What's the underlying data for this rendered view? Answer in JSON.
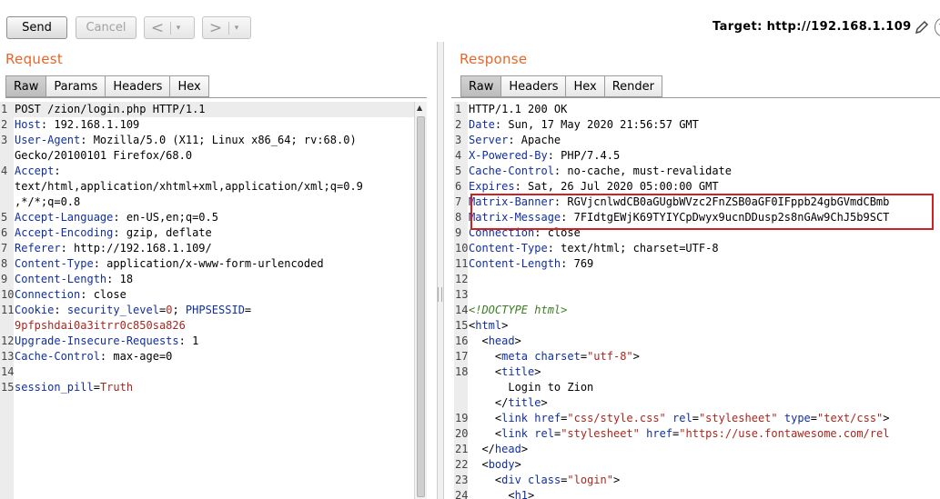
{
  "toolbar": {
    "send": "Send",
    "cancel": "Cancel",
    "back": "<",
    "forward": ">",
    "dropdown": "▾",
    "target_label": "Target: ",
    "target_value": "http://192.168.1.109"
  },
  "request": {
    "title": "Request",
    "tabs": [
      "Raw",
      "Params",
      "Headers",
      "Hex"
    ],
    "active_tab": "Raw",
    "lines": [
      {
        "n": "1",
        "parts": [
          {
            "t": "POST /zion/login.php HTTP/1.1",
            "c": ""
          }
        ]
      },
      {
        "n": "2",
        "parts": [
          {
            "t": "Host",
            "c": "k"
          },
          {
            "t": ": 192.168.1.109",
            "c": ""
          }
        ]
      },
      {
        "n": "3",
        "parts": [
          {
            "t": "User-Agent",
            "c": "k"
          },
          {
            "t": ": Mozilla/5.0 (X11; Linux x86_64; rv:68.0)",
            "c": ""
          }
        ]
      },
      {
        "n": "",
        "parts": [
          {
            "t": "Gecko/20100101 Firefox/68.0",
            "c": ""
          }
        ]
      },
      {
        "n": "4",
        "parts": [
          {
            "t": "Accept",
            "c": "k"
          },
          {
            "t": ":",
            "c": ""
          }
        ]
      },
      {
        "n": "",
        "parts": [
          {
            "t": "text/html,application/xhtml+xml,application/xml;q=0.9",
            "c": ""
          }
        ]
      },
      {
        "n": "",
        "parts": [
          {
            "t": ",*/*;q=0.8",
            "c": ""
          }
        ]
      },
      {
        "n": "5",
        "parts": [
          {
            "t": "Accept-Language",
            "c": "k"
          },
          {
            "t": ": en-US,en;q=0.5",
            "c": ""
          }
        ]
      },
      {
        "n": "6",
        "parts": [
          {
            "t": "Accept-Encoding",
            "c": "k"
          },
          {
            "t": ": gzip, deflate",
            "c": ""
          }
        ]
      },
      {
        "n": "7",
        "parts": [
          {
            "t": "Referer",
            "c": "k"
          },
          {
            "t": ": http://192.168.1.109/",
            "c": ""
          }
        ]
      },
      {
        "n": "8",
        "parts": [
          {
            "t": "Content-Type",
            "c": "k"
          },
          {
            "t": ": application/x-www-form-urlencoded",
            "c": ""
          }
        ]
      },
      {
        "n": "9",
        "parts": [
          {
            "t": "Content-Length",
            "c": "k"
          },
          {
            "t": ": 18",
            "c": ""
          }
        ]
      },
      {
        "n": "10",
        "parts": [
          {
            "t": "Connection",
            "c": "k"
          },
          {
            "t": ": close",
            "c": ""
          }
        ]
      },
      {
        "n": "11",
        "parts": [
          {
            "t": "Cookie",
            "c": "k"
          },
          {
            "t": ": ",
            "c": ""
          },
          {
            "t": "security_level",
            "c": "k"
          },
          {
            "t": "=",
            "c": ""
          },
          {
            "t": "0",
            "c": "v"
          },
          {
            "t": "; ",
            "c": ""
          },
          {
            "t": "PHPSESSID",
            "c": "k"
          },
          {
            "t": "=",
            "c": ""
          }
        ]
      },
      {
        "n": "",
        "parts": [
          {
            "t": "9pfpshdai0a3itrr0c850sa826",
            "c": "v"
          }
        ]
      },
      {
        "n": "12",
        "parts": [
          {
            "t": "Upgrade-Insecure-Requests",
            "c": "k"
          },
          {
            "t": ": 1",
            "c": ""
          }
        ]
      },
      {
        "n": "13",
        "parts": [
          {
            "t": "Cache-Control",
            "c": "k"
          },
          {
            "t": ": max-age=0",
            "c": ""
          }
        ]
      },
      {
        "n": "14",
        "parts": []
      },
      {
        "n": "15",
        "parts": [
          {
            "t": "session_pill",
            "c": "k"
          },
          {
            "t": "=",
            "c": ""
          },
          {
            "t": "Truth",
            "c": "v"
          }
        ]
      }
    ]
  },
  "response": {
    "title": "Response",
    "tabs": [
      "Raw",
      "Headers",
      "Hex",
      "Render"
    ],
    "active_tab": "Raw",
    "lines": [
      {
        "n": "1",
        "parts": [
          {
            "t": "HTTP/1.1 200 OK",
            "c": ""
          }
        ]
      },
      {
        "n": "2",
        "parts": [
          {
            "t": "Date",
            "c": "k"
          },
          {
            "t": ": Sun, 17 May 2020 21:56:57 GMT",
            "c": ""
          }
        ]
      },
      {
        "n": "3",
        "parts": [
          {
            "t": "Server",
            "c": "k"
          },
          {
            "t": ": Apache",
            "c": ""
          }
        ]
      },
      {
        "n": "4",
        "parts": [
          {
            "t": "X-Powered-By",
            "c": "k"
          },
          {
            "t": ": PHP/7.4.5",
            "c": ""
          }
        ]
      },
      {
        "n": "5",
        "parts": [
          {
            "t": "Cache-Control",
            "c": "k"
          },
          {
            "t": ": no-cache, must-revalidate",
            "c": ""
          }
        ]
      },
      {
        "n": "6",
        "parts": [
          {
            "t": "Expires",
            "c": "k"
          },
          {
            "t": ": Sat, 26 Jul 2020 05:00:00 GMT",
            "c": ""
          }
        ]
      },
      {
        "n": "7",
        "parts": [
          {
            "t": "Matrix-Banner",
            "c": "k"
          },
          {
            "t": ": RGVjcnlwdCB0aGUgbWVzc2FnZSB0aGF0IFppb24gbGVmdCBmb",
            "c": ""
          }
        ]
      },
      {
        "n": "8",
        "parts": [
          {
            "t": "Matrix-Message",
            "c": "k"
          },
          {
            "t": ": 7FIdtgEWjK69TYIYCpDwyx9ucnDDusp2s8nGAw9ChJ5b9SCT",
            "c": ""
          }
        ]
      },
      {
        "n": "9",
        "parts": [
          {
            "t": "Connection",
            "c": "k"
          },
          {
            "t": ": close",
            "c": ""
          }
        ]
      },
      {
        "n": "10",
        "parts": [
          {
            "t": "Content-Type",
            "c": "k"
          },
          {
            "t": ": text/html; charset=UTF-8",
            "c": ""
          }
        ]
      },
      {
        "n": "11",
        "parts": [
          {
            "t": "Content-Length",
            "c": "k"
          },
          {
            "t": ": 769",
            "c": ""
          }
        ]
      },
      {
        "n": "12",
        "parts": []
      },
      {
        "n": "13",
        "parts": []
      },
      {
        "n": "14",
        "parts": [
          {
            "t": "<!DOCTYPE html>",
            "c": "cm"
          }
        ]
      },
      {
        "n": "15",
        "parts": [
          {
            "t": "<",
            "c": ""
          },
          {
            "t": "html",
            "c": "tg"
          },
          {
            "t": ">",
            "c": ""
          }
        ]
      },
      {
        "n": "16",
        "parts": [
          {
            "t": "  <",
            "c": ""
          },
          {
            "t": "head",
            "c": "tg"
          },
          {
            "t": ">",
            "c": ""
          }
        ]
      },
      {
        "n": "17",
        "parts": [
          {
            "t": "    <",
            "c": ""
          },
          {
            "t": "meta",
            "c": "tg"
          },
          {
            "t": " ",
            "c": ""
          },
          {
            "t": "charset",
            "c": "at"
          },
          {
            "t": "=",
            "c": ""
          },
          {
            "t": "\"utf-8\"",
            "c": "val"
          },
          {
            "t": ">",
            "c": ""
          }
        ]
      },
      {
        "n": "18",
        "parts": [
          {
            "t": "    <",
            "c": ""
          },
          {
            "t": "title",
            "c": "tg"
          },
          {
            "t": ">",
            "c": ""
          }
        ]
      },
      {
        "n": "",
        "parts": [
          {
            "t": "      Login to Zion",
            "c": ""
          }
        ]
      },
      {
        "n": "",
        "parts": [
          {
            "t": "    </",
            "c": ""
          },
          {
            "t": "title",
            "c": "tg"
          },
          {
            "t": ">",
            "c": ""
          }
        ]
      },
      {
        "n": "19",
        "parts": [
          {
            "t": "    <",
            "c": ""
          },
          {
            "t": "link",
            "c": "tg"
          },
          {
            "t": " ",
            "c": ""
          },
          {
            "t": "href",
            "c": "at"
          },
          {
            "t": "=",
            "c": ""
          },
          {
            "t": "\"css/style.css\"",
            "c": "val"
          },
          {
            "t": " ",
            "c": ""
          },
          {
            "t": "rel",
            "c": "at"
          },
          {
            "t": "=",
            "c": ""
          },
          {
            "t": "\"stylesheet\"",
            "c": "val"
          },
          {
            "t": " ",
            "c": ""
          },
          {
            "t": "type",
            "c": "at"
          },
          {
            "t": "=",
            "c": ""
          },
          {
            "t": "\"text/css\"",
            "c": "val"
          },
          {
            "t": ">",
            "c": ""
          }
        ]
      },
      {
        "n": "20",
        "parts": [
          {
            "t": "    <",
            "c": ""
          },
          {
            "t": "link",
            "c": "tg"
          },
          {
            "t": " ",
            "c": ""
          },
          {
            "t": "rel",
            "c": "at"
          },
          {
            "t": "=",
            "c": ""
          },
          {
            "t": "\"stylesheet\"",
            "c": "val"
          },
          {
            "t": " ",
            "c": ""
          },
          {
            "t": "href",
            "c": "at"
          },
          {
            "t": "=",
            "c": ""
          },
          {
            "t": "\"https://use.fontawesome.com/rel",
            "c": "val"
          }
        ]
      },
      {
        "n": "21",
        "parts": [
          {
            "t": "  </",
            "c": ""
          },
          {
            "t": "head",
            "c": "tg"
          },
          {
            "t": ">",
            "c": ""
          }
        ]
      },
      {
        "n": "22",
        "parts": [
          {
            "t": "  <",
            "c": ""
          },
          {
            "t": "body",
            "c": "tg"
          },
          {
            "t": ">",
            "c": ""
          }
        ]
      },
      {
        "n": "23",
        "parts": [
          {
            "t": "    <",
            "c": ""
          },
          {
            "t": "div",
            "c": "tg"
          },
          {
            "t": " ",
            "c": ""
          },
          {
            "t": "class",
            "c": "at"
          },
          {
            "t": "=",
            "c": ""
          },
          {
            "t": "\"login\"",
            "c": "val"
          },
          {
            "t": ">",
            "c": ""
          }
        ]
      },
      {
        "n": "24",
        "parts": [
          {
            "t": "      <",
            "c": ""
          },
          {
            "t": "h1",
            "c": "tg"
          },
          {
            "t": ">",
            "c": ""
          }
        ]
      }
    ]
  },
  "colors": {
    "accent": "#e8662a",
    "header_key": "#102f9f",
    "value": "#a8271e",
    "highlight_box": "#d21f1f"
  }
}
